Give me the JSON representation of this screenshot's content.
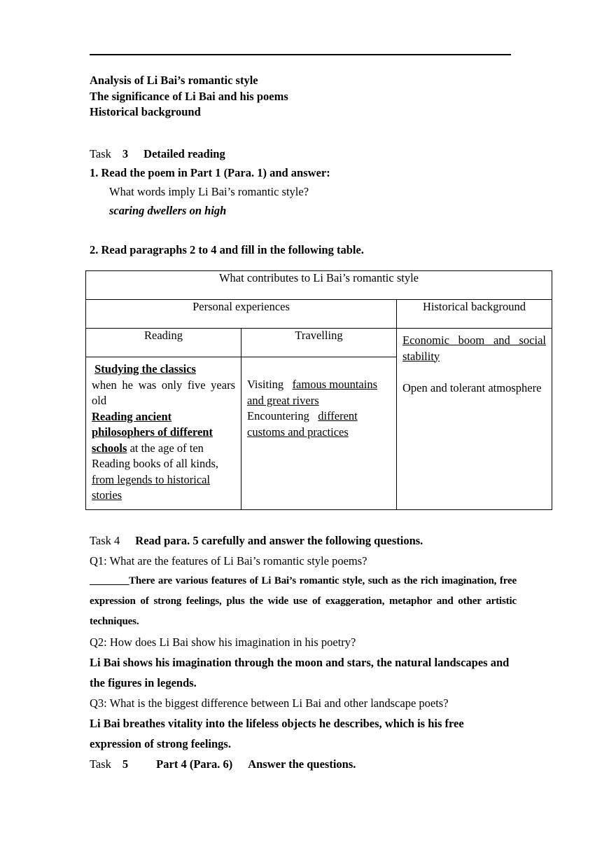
{
  "document": {
    "header_lines": [
      "Analysis of Li Bai’s romantic style",
      "The significance of Li Bai and his poems",
      "Historical background"
    ],
    "task3": {
      "label": "Task",
      "number": "3",
      "title": "Detailed reading",
      "item1": "1. Read the poem in Part 1 (Para. 1) and answer:",
      "question": "What words imply Li Bai’s romantic style?",
      "answer": "scaring dwellers on high"
    },
    "section2_heading": "2. Read paragraphs 2 to 4 and fill in the following table.",
    "table": {
      "title": "What contributes to Li Bai’s romantic style",
      "group_headers": [
        "Personal experiences",
        "Historical background"
      ],
      "sub_headers": [
        "Reading",
        "Travelling"
      ],
      "reading_cell": {
        "line1_underlined_bold": "Studying the classics",
        "line2_plain": "when he was only five years old",
        "line3_underlined_bold": "Reading ancient philosophers of different schools",
        "line3_tail_plain": " at the age of ten",
        "line4_plain": "Reading books of all kinds, ",
        "line4_underlined": "from legends to historical stories "
      },
      "travelling_cell": {
        "line1_plain": "Visiting",
        "line1_underlined": "famous mountains and great rivers",
        "line2_plain": "Encountering",
        "line2_underlined": "different customs and practices"
      },
      "historical_cell": {
        "line1_underlined": "Economic boom and social stability",
        "line2_plain": "Open and tolerant atmosphere"
      }
    },
    "task4": {
      "label": "Task",
      "number": "4",
      "title": "Read para. 5 carefully and answer the following questions.",
      "q1": "Q1: What are the features of Li Bai’s romantic style poems?",
      "a1_blank": "________",
      "a1": "There are various features of Li Bai’s romantic style, such as the rich imagination, free expression of strong feelings, plus the wide use of exaggeration, metaphor and other artistic techniques.",
      "q2": "Q2: How does Li Bai show his imagination in his poetry?",
      "a2": "Li Bai shows his imagination through the moon and stars, the natural landscapes and the figures in legends.",
      "q3": "Q3: What is the biggest difference between Li Bai and other landscape poets?",
      "a3": "Li Bai breathes vitality into the lifeless objects he describes, which is his free expression of strong feelings."
    },
    "task5": {
      "label": "Task",
      "number": "5",
      "part": "Part 4 (Para. 6)",
      "title": "Answer the questions."
    }
  }
}
